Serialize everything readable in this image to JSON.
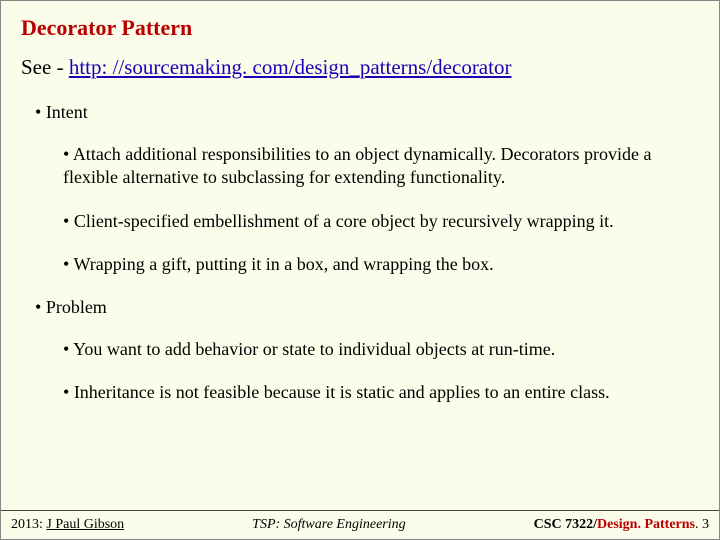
{
  "title": "Decorator Pattern",
  "see_prefix": "See -  ",
  "see_url": "http: //sourcemaking. com/design_patterns/decorator",
  "sections": {
    "intent_label": "Intent",
    "intent_items": [
      "Attach additional responsibilities to an object dynamically. Decorators provide a flexible alternative to subclassing for extending functionality.",
      "Client-specified embellishment of a core object by recursively wrapping it.",
      "Wrapping a gift, putting it in a box, and wrapping the box."
    ],
    "problem_label": "Problem",
    "problem_items": [
      "You want to add behavior or state to individual objects at run-time.",
      "Inheritance is not feasible because it is static and applies to an entire class."
    ]
  },
  "footer": {
    "left_year": "2013: ",
    "left_name": "J Paul Gibson",
    "center_prefix": "TSP: ",
    "center_rest": "Software Engineering",
    "right_course": "CSC 7322/",
    "right_topic": "Design. Patterns",
    "right_page_prefix": ". ",
    "right_page": "3"
  }
}
